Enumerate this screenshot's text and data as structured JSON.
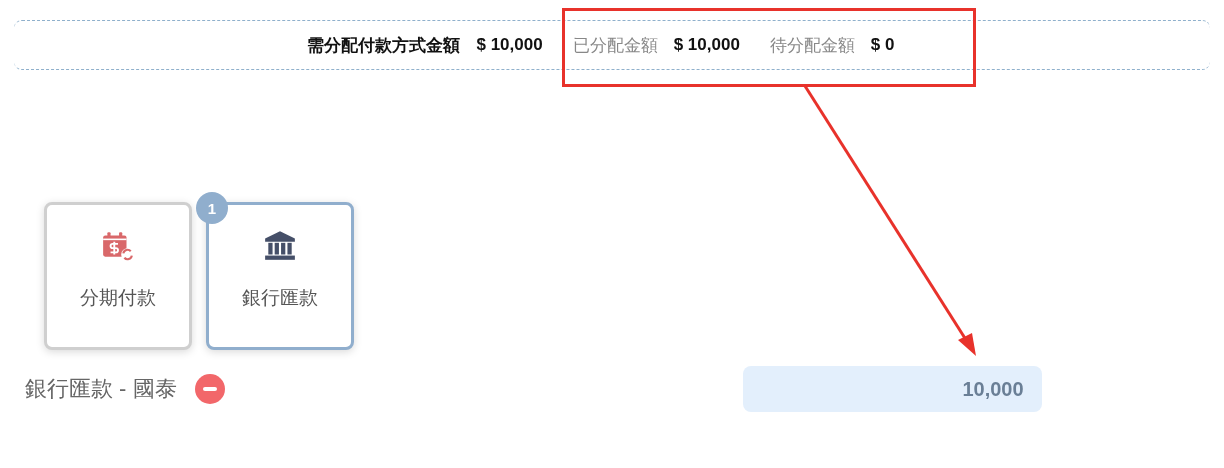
{
  "summary": [
    {
      "label": "需分配付款方式金額",
      "amount": "$ 10,000",
      "emphasis": true
    },
    {
      "label": "已分配金額",
      "amount": "$ 10,000",
      "emphasis": false
    },
    {
      "label": "待分配金額",
      "amount": "$ 0",
      "emphasis": false
    }
  ],
  "methods": [
    {
      "label": "分期付款",
      "kind": "installment",
      "selected": false
    },
    {
      "label": "銀行匯款",
      "kind": "bank",
      "selected": true,
      "badge": "1"
    }
  ],
  "entries": [
    {
      "label": "銀行匯款 - 國泰",
      "value": "10,000"
    }
  ]
}
